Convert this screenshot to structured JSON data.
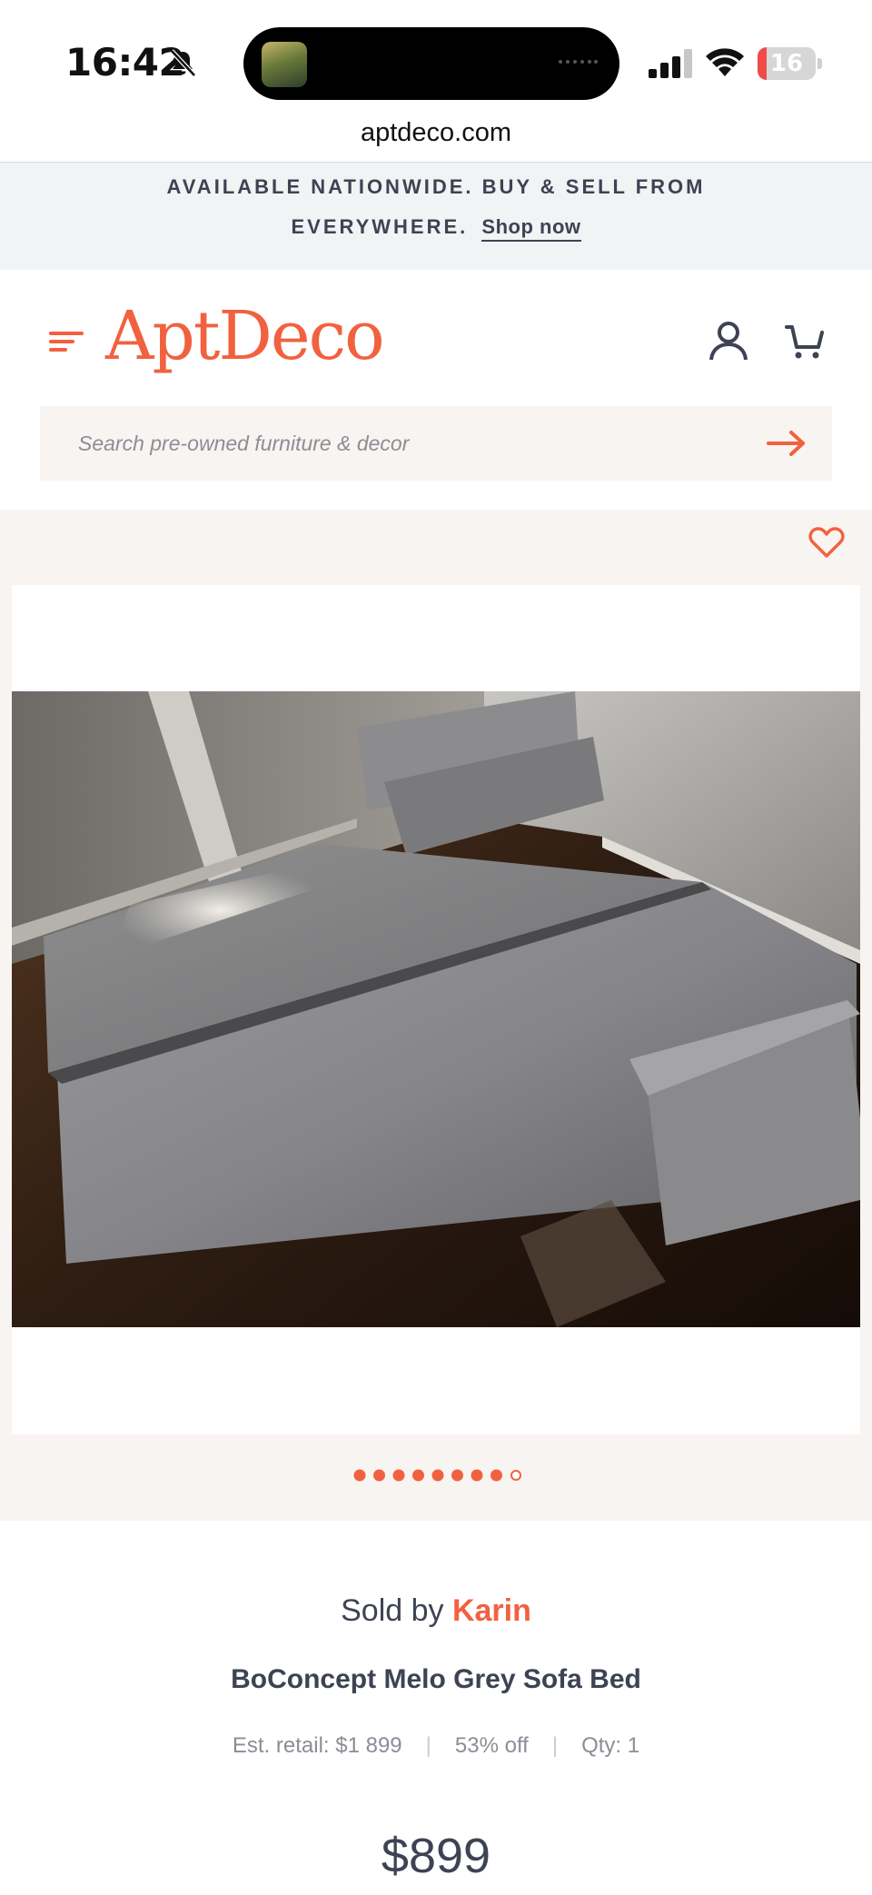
{
  "status_bar": {
    "time": "16:42",
    "battery_level": "16",
    "battery_fraction": 0.16
  },
  "browser": {
    "url": "aptdeco.com"
  },
  "promo": {
    "line1": "AVAILABLE NATIONWIDE. BUY & SELL FROM",
    "line2": "EVERYWHERE.",
    "link_label": "Shop now"
  },
  "header": {
    "logo_text": "AptDeco",
    "menu_icon": "hamburger-menu-icon",
    "account_icon": "user-icon",
    "cart_icon": "cart-icon"
  },
  "search": {
    "placeholder": "Search pre-owned furniture & decor",
    "submit_icon": "arrow-right-icon"
  },
  "gallery": {
    "favorite_icon": "heart-icon",
    "image_count": 9,
    "active_index": 8
  },
  "product": {
    "sold_by_label": "Sold by",
    "seller": "Karin",
    "title": "BoConcept Melo Grey Sofa Bed",
    "est_retail": "Est. retail: $1 899",
    "discount": "53% off",
    "qty": "Qty: 1",
    "price": "$899"
  },
  "colors": {
    "accent": "#f2613f",
    "text": "#3d4353",
    "muted": "#8a8e96",
    "cream": "#f8f4f1",
    "banner": "#f1f3f4"
  }
}
